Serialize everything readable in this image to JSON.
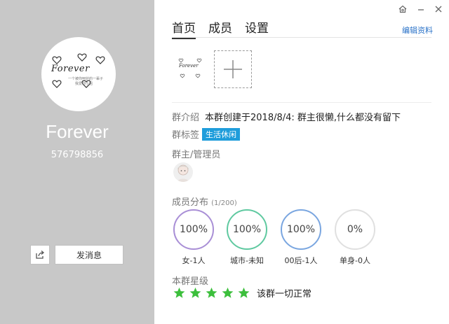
{
  "window": {
    "controls": {
      "skin": "skin-icon",
      "minimize": "minimize-icon",
      "close": "close-icon"
    }
  },
  "sidebar": {
    "avatar_brand": "Forever",
    "avatar_line1": "一个被你呵护的一辈子",
    "avatar_line2": "我爱你小姐",
    "group_name": "Forever",
    "group_id": "576798856",
    "share_icon": "share-icon",
    "send_message": "发消息"
  },
  "tabs": [
    {
      "label": "首页",
      "active": true
    },
    {
      "label": "成员",
      "active": false
    },
    {
      "label": "设置",
      "active": false
    }
  ],
  "edit_profile": "编辑资料",
  "album": {
    "thumb_brand": "Forever",
    "add_icon": "plus-icon"
  },
  "intro": {
    "label": "群介绍",
    "text": "本群创建于2018/8/4:  群主很懒,什么都没有留下"
  },
  "tags": {
    "label": "群标签",
    "tag": "生活休闲"
  },
  "admins": {
    "label": "群主/管理员"
  },
  "distribution": {
    "label": "成员分布",
    "count": "(1/200)",
    "items": [
      {
        "value": "100%",
        "label": "女-1人",
        "color": "#a98fd6"
      },
      {
        "value": "100%",
        "label": "城市-未知",
        "color": "#5fc9a0"
      },
      {
        "value": "100%",
        "label": "00后-1人",
        "color": "#7aa6e0"
      },
      {
        "value": "0%",
        "label": "单身-0人",
        "color": "#e0e0e0"
      }
    ]
  },
  "level": {
    "label": "本群星级",
    "stars": 5,
    "star_color": "#3cbf3c",
    "status": "该群一切正常"
  }
}
